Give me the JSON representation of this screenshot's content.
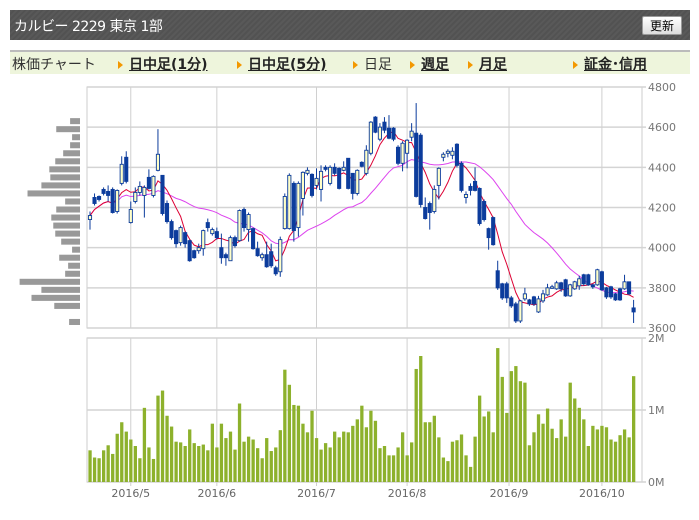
{
  "header": {
    "title": "カルビー 2229 東京 1部",
    "refresh_label": "更新"
  },
  "nav": {
    "label": "株価チャート",
    "items": [
      {
        "label": "日中足(1分)",
        "link": true
      },
      {
        "label": "日中足(5分)",
        "link": true
      },
      {
        "label": "日足",
        "link": false
      },
      {
        "label": "週足",
        "link": true
      },
      {
        "label": "月足",
        "link": true
      },
      {
        "label": "証金･信用",
        "link": true
      }
    ]
  },
  "chart_data": {
    "type": "candlestick",
    "price_axis": {
      "range": [
        3600,
        4800
      ],
      "ticks": [
        "4800",
        "4600",
        "4400",
        "4200",
        "4000",
        "3800",
        "3600"
      ]
    },
    "volume_axis": {
      "range": [
        0,
        2
      ],
      "ticks": [
        "2M",
        "1M",
        "0M"
      ],
      "unit": "M"
    },
    "x_ticks": [
      {
        "label": "2016/5",
        "day_index": 9
      },
      {
        "label": "2016/6",
        "day_index": 28
      },
      {
        "label": "2016/7",
        "day_index": 50
      },
      {
        "label": "2016/8",
        "day_index": 70
      },
      {
        "label": "2016/9",
        "day_index": 92.5
      },
      {
        "label": "2016/10",
        "day_index": 113
      }
    ],
    "colors": {
      "up_fill": "#ffffc8",
      "down_fill": "#0c3c9c",
      "candle_line": "#0c3c9c",
      "ma_short": "#dd0033",
      "ma_long": "#dd44ee",
      "volume": "#8db12c",
      "profile": "#999999"
    },
    "ohlc": [
      [
        4140,
        4180,
        4090,
        4160
      ],
      [
        4250,
        4270,
        4210,
        4220
      ],
      [
        4255,
        4260,
        4230,
        4240
      ],
      [
        4290,
        4300,
        4260,
        4270
      ],
      [
        4280,
        4310,
        4230,
        4260
      ],
      [
        4290,
        4300,
        4170,
        4175
      ],
      [
        4180,
        4290,
        4170,
        4285
      ],
      [
        4320,
        4455,
        4310,
        4415
      ],
      [
        4450,
        4480,
        4320,
        4330
      ],
      [
        4125,
        4230,
        4120,
        4190
      ],
      [
        4230,
        4300,
        4220,
        4275
      ],
      [
        4275,
        4330,
        4260,
        4305
      ],
      [
        4260,
        4310,
        4150,
        4300
      ],
      [
        4350,
        4390,
        4290,
        4295
      ],
      [
        4260,
        4360,
        4250,
        4355
      ],
      [
        4385,
        4590,
        4380,
        4465
      ],
      [
        4360,
        4360,
        4160,
        4170
      ],
      [
        4220,
        4235,
        4120,
        4130
      ],
      [
        4130,
        4140,
        4040,
        4050
      ],
      [
        4085,
        4090,
        4000,
        4020
      ],
      [
        4025,
        4110,
        4010,
        4100
      ],
      [
        4075,
        4080,
        4000,
        4020
      ],
      [
        4035,
        4040,
        3930,
        3935
      ],
      [
        3985,
        3990,
        3945,
        3950
      ],
      [
        3985,
        4020,
        3970,
        4000
      ],
      [
        3995,
        4090,
        3960,
        4085
      ],
      [
        4125,
        4145,
        4080,
        4100
      ],
      [
        4070,
        4100,
        4060,
        4090
      ],
      [
        4080,
        4100,
        4040,
        4050
      ],
      [
        4000,
        4070,
        3920,
        3950
      ],
      [
        3965,
        3975,
        3910,
        3950
      ],
      [
        3935,
        4060,
        3935,
        4050
      ],
      [
        4050,
        4060,
        4000,
        4010
      ],
      [
        4035,
        4190,
        4030,
        4185
      ],
      [
        4190,
        4200,
        4080,
        4100
      ],
      [
        4090,
        4175,
        4030,
        4165
      ],
      [
        4095,
        4100,
        3990,
        3995
      ],
      [
        3995,
        4030,
        3955,
        3960
      ],
      [
        3950,
        3975,
        3935,
        3965
      ],
      [
        3965,
        4030,
        3900,
        3905
      ],
      [
        3980,
        4020,
        3900,
        3910
      ],
      [
        3900,
        3910,
        3860,
        3870
      ],
      [
        3880,
        4055,
        3855,
        4040
      ],
      [
        4095,
        4270,
        4090,
        4255
      ],
      [
        4095,
        4370,
        4090,
        4360
      ],
      [
        4320,
        4330,
        4030,
        4085
      ],
      [
        4100,
        4330,
        4055,
        4320
      ],
      [
        4245,
        4380,
        4160,
        4375
      ],
      [
        4370,
        4400,
        4360,
        4385
      ],
      [
        4365,
        4370,
        4250,
        4260
      ],
      [
        4310,
        4395,
        4290,
        4345
      ],
      [
        4290,
        4410,
        4230,
        4380
      ],
      [
        4400,
        4410,
        4380,
        4390
      ],
      [
        4320,
        4410,
        4310,
        4400
      ],
      [
        4400,
        4420,
        4360,
        4370
      ],
      [
        4395,
        4400,
        4290,
        4295
      ],
      [
        4385,
        4430,
        4380,
        4400
      ],
      [
        4445,
        4445,
        4290,
        4295
      ],
      [
        4370,
        4370,
        4240,
        4270
      ],
      [
        4270,
        4390,
        4260,
        4385
      ],
      [
        4425,
        4430,
        4400,
        4405
      ],
      [
        4370,
        4510,
        4360,
        4485
      ],
      [
        4470,
        4630,
        4460,
        4625
      ],
      [
        4650,
        4655,
        4570,
        4575
      ],
      [
        4540,
        4620,
        4530,
        4600
      ],
      [
        4625,
        4650,
        4570,
        4585
      ],
      [
        4595,
        4660,
        4540,
        4545
      ],
      [
        4595,
        4600,
        4530,
        4540
      ],
      [
        4500,
        4510,
        4410,
        4420
      ],
      [
        4420,
        4530,
        4380,
        4520
      ],
      [
        4470,
        4540,
        4395,
        4535
      ],
      [
        4550,
        4620,
        4530,
        4580
      ],
      [
        4570,
        4720,
        4250,
        4255
      ],
      [
        4560,
        4570,
        4200,
        4215
      ],
      [
        4200,
        4250,
        4140,
        4145
      ],
      [
        4220,
        4230,
        4090,
        4175
      ],
      [
        4180,
        4310,
        4170,
        4290
      ],
      [
        4310,
        4400,
        4240,
        4395
      ],
      [
        4450,
        4475,
        4430,
        4465
      ],
      [
        4470,
        4490,
        4450,
        4480
      ],
      [
        4460,
        4500,
        4440,
        4480
      ],
      [
        4515,
        4520,
        4400,
        4410
      ],
      [
        4420,
        4430,
        4275,
        4285
      ],
      [
        4250,
        4280,
        4220,
        4265
      ],
      [
        4305,
        4320,
        4260,
        4285
      ],
      [
        4330,
        4400,
        4280,
        4285
      ],
      [
        4295,
        4300,
        4110,
        4120
      ],
      [
        4230,
        4240,
        4130,
        4140
      ],
      [
        4095,
        4100,
        3990,
        4050
      ],
      [
        4150,
        4155,
        4010,
        4015
      ],
      [
        3885,
        3935,
        3790,
        3800
      ],
      [
        3820,
        3825,
        3740,
        3750
      ],
      [
        3820,
        3830,
        3725,
        3750
      ],
      [
        3750,
        3760,
        3700,
        3710
      ],
      [
        3720,
        3730,
        3625,
        3635
      ],
      [
        3635,
        3740,
        3625,
        3735
      ],
      [
        3745,
        3800,
        3735,
        3770
      ],
      [
        3740,
        3745,
        3710,
        3720
      ],
      [
        3755,
        3760,
        3710,
        3720
      ],
      [
        3680,
        3760,
        3675,
        3745
      ],
      [
        3735,
        3790,
        3725,
        3770
      ],
      [
        3765,
        3820,
        3760,
        3800
      ],
      [
        3800,
        3815,
        3795,
        3805
      ],
      [
        3795,
        3835,
        3790,
        3825
      ],
      [
        3825,
        3830,
        3780,
        3795
      ],
      [
        3840,
        3845,
        3755,
        3760
      ],
      [
        3760,
        3820,
        3755,
        3815
      ],
      [
        3795,
        3835,
        3790,
        3830
      ],
      [
        3810,
        3860,
        3790,
        3845
      ],
      [
        3865,
        3870,
        3810,
        3820
      ],
      [
        3865,
        3870,
        3810,
        3815
      ],
      [
        3815,
        3820,
        3795,
        3805
      ],
      [
        3815,
        3895,
        3810,
        3890
      ],
      [
        3880,
        3885,
        3785,
        3790
      ],
      [
        3800,
        3805,
        3745,
        3755
      ],
      [
        3805,
        3810,
        3745,
        3755
      ],
      [
        3770,
        3775,
        3735,
        3740
      ],
      [
        3795,
        3800,
        3735,
        3740
      ],
      [
        3795,
        3865,
        3790,
        3830
      ],
      [
        3830,
        3830,
        3765,
        3770
      ],
      [
        3700,
        3740,
        3625,
        3680
      ]
    ],
    "volume": [
      0.44,
      0.34,
      0.33,
      0.44,
      0.51,
      0.39,
      0.67,
      0.83,
      0.7,
      0.59,
      0.5,
      0.33,
      1.03,
      0.48,
      0.32,
      1.2,
      1.27,
      0.92,
      0.77,
      0.56,
      0.55,
      0.5,
      0.73,
      0.54,
      0.5,
      0.52,
      0.44,
      0.81,
      0.48,
      0.81,
      0.61,
      0.7,
      0.45,
      1.09,
      0.56,
      0.63,
      0.59,
      0.47,
      0.33,
      0.61,
      0.43,
      0.48,
      0.72,
      1.56,
      1.35,
      1.07,
      1.06,
      0.81,
      0.69,
      0.99,
      0.61,
      0.45,
      0.54,
      0.48,
      0.7,
      0.62,
      0.7,
      0.69,
      0.78,
      0.87,
      1.06,
      0.76,
      0.99,
      0.85,
      0.47,
      0.5,
      0.37,
      0.37,
      0.48,
      0.69,
      0.37,
      0.55,
      1.57,
      1.75,
      0.83,
      0.83,
      0.92,
      0.62,
      0.34,
      0.29,
      0.56,
      0.58,
      0.66,
      0.37,
      0.21,
      0.63,
      1.2,
      0.91,
      0.98,
      0.69,
      1.86,
      1.46,
      0.96,
      1.54,
      1.61,
      1.4,
      1.38,
      0.51,
      0.69,
      0.94,
      0.81,
      1.02,
      0.74,
      0.61,
      0.87,
      0.63,
      1.38,
      1.16,
      1.03,
      0.87,
      0.5,
      0.78,
      0.73,
      0.78,
      0.76,
      0.59,
      0.56,
      0.65,
      0.73,
      0.62,
      1.47
    ],
    "volume_profile": {
      "price_centers": [
        4630,
        4590,
        4550,
        4510,
        4470,
        4430,
        4390,
        4350,
        4310,
        4270,
        4230,
        4190,
        4150,
        4110,
        4070,
        4030,
        3990,
        3950,
        3910,
        3870,
        3830,
        3790,
        3750,
        3710,
        3670,
        3630
      ],
      "relative_volume": [
        30,
        72,
        24,
        30,
        51,
        75,
        93,
        90,
        117,
        159,
        45,
        72,
        87,
        81,
        75,
        57,
        24,
        63,
        36,
        45,
        183,
        117,
        147,
        78,
        0,
        33
      ]
    }
  }
}
